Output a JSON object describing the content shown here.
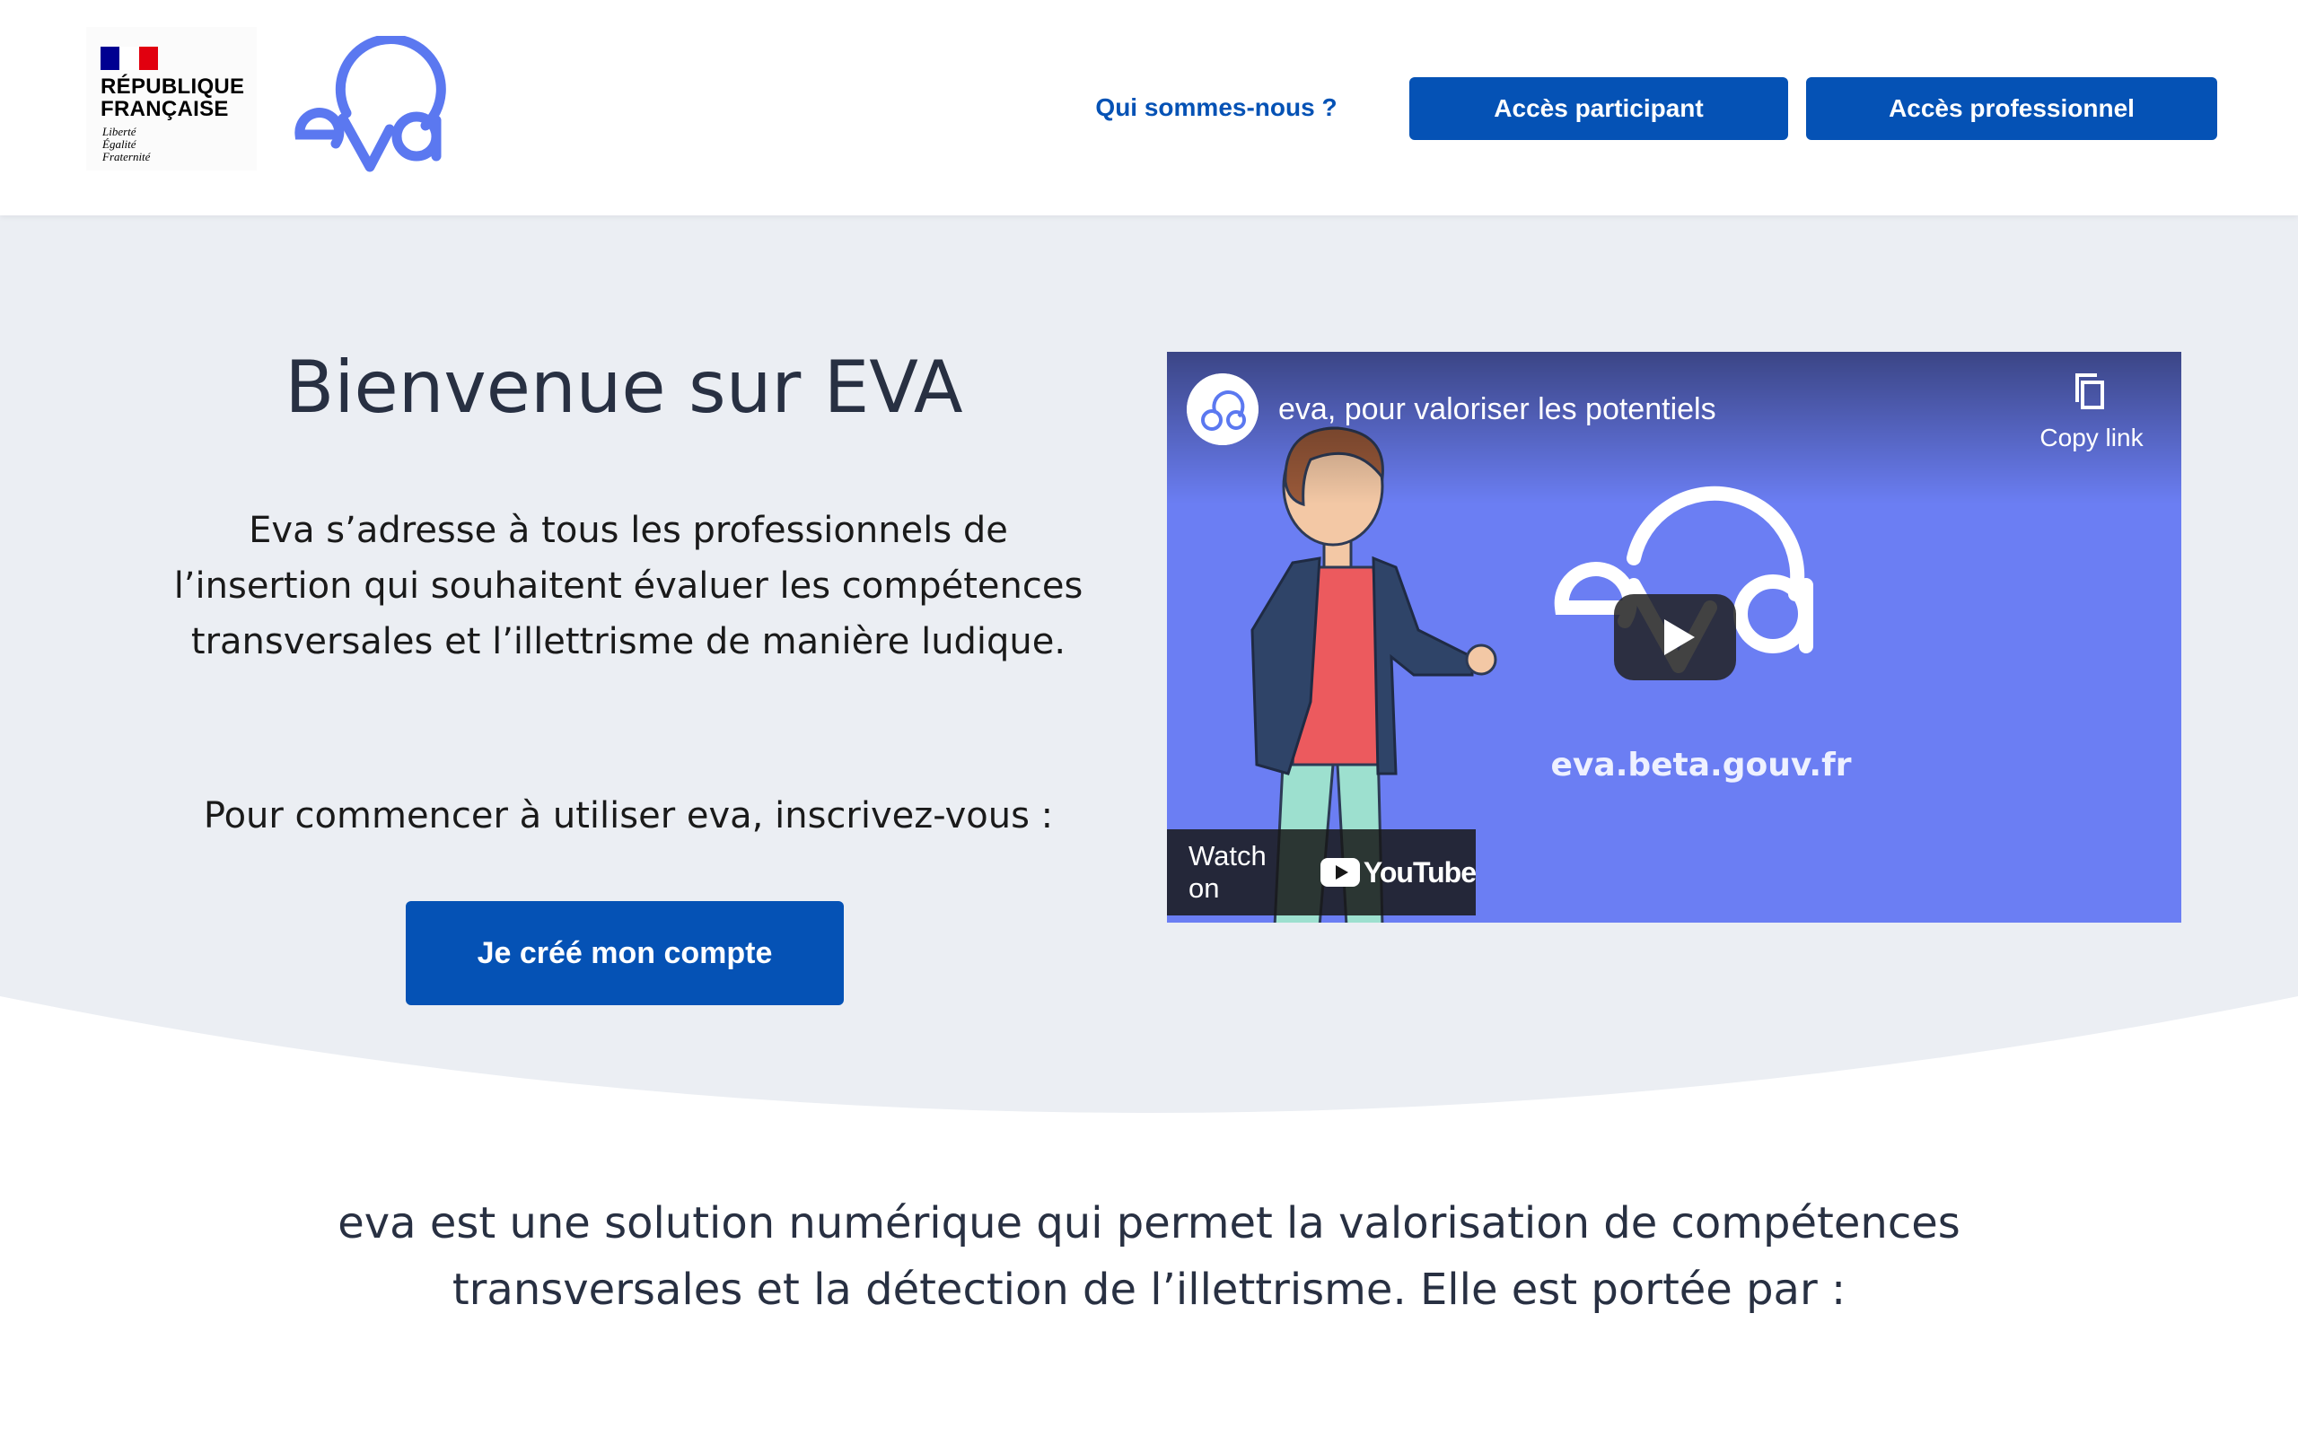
{
  "header": {
    "republique": {
      "title_line1": "RÉPUBLIQUE",
      "title_line2": "FRANÇAISE",
      "motto_line1": "Liberté",
      "motto_line2": "Égalité",
      "motto_line3": "Fraternité"
    },
    "logo_icon": "eva-logo",
    "nav_link": "Qui sommes-nous ?",
    "btn_participant": "Accès participant",
    "btn_pro": "Accès professionnel"
  },
  "hero": {
    "title": "Bienvenue sur EVA",
    "text": "Eva s’adresse à tous les professionnels de l’insertion qui souhaitent évaluer les compétences transversales et l’illettrisme de manière ludique.",
    "text2": "Pour commencer à utiliser eva, inscrivez-vous  :",
    "cta": "Je créé mon compte"
  },
  "video": {
    "title": "eva, pour valoriser les potentiels",
    "copy_link": "Copy link",
    "url": "eva.beta.gouv.fr",
    "watch_on": "Watch on",
    "youtube": "YouTube"
  },
  "bottom": {
    "text": "eva est une solution numérique qui permet la valorisation de compétences transversales et la détection de l’illettrisme. Elle est portée par :"
  },
  "colors": {
    "primary": "#0552b5",
    "hero_bg": "#ebeef3",
    "eva_logo": "#5b78f0",
    "video_bg": "#6b7ef3"
  }
}
